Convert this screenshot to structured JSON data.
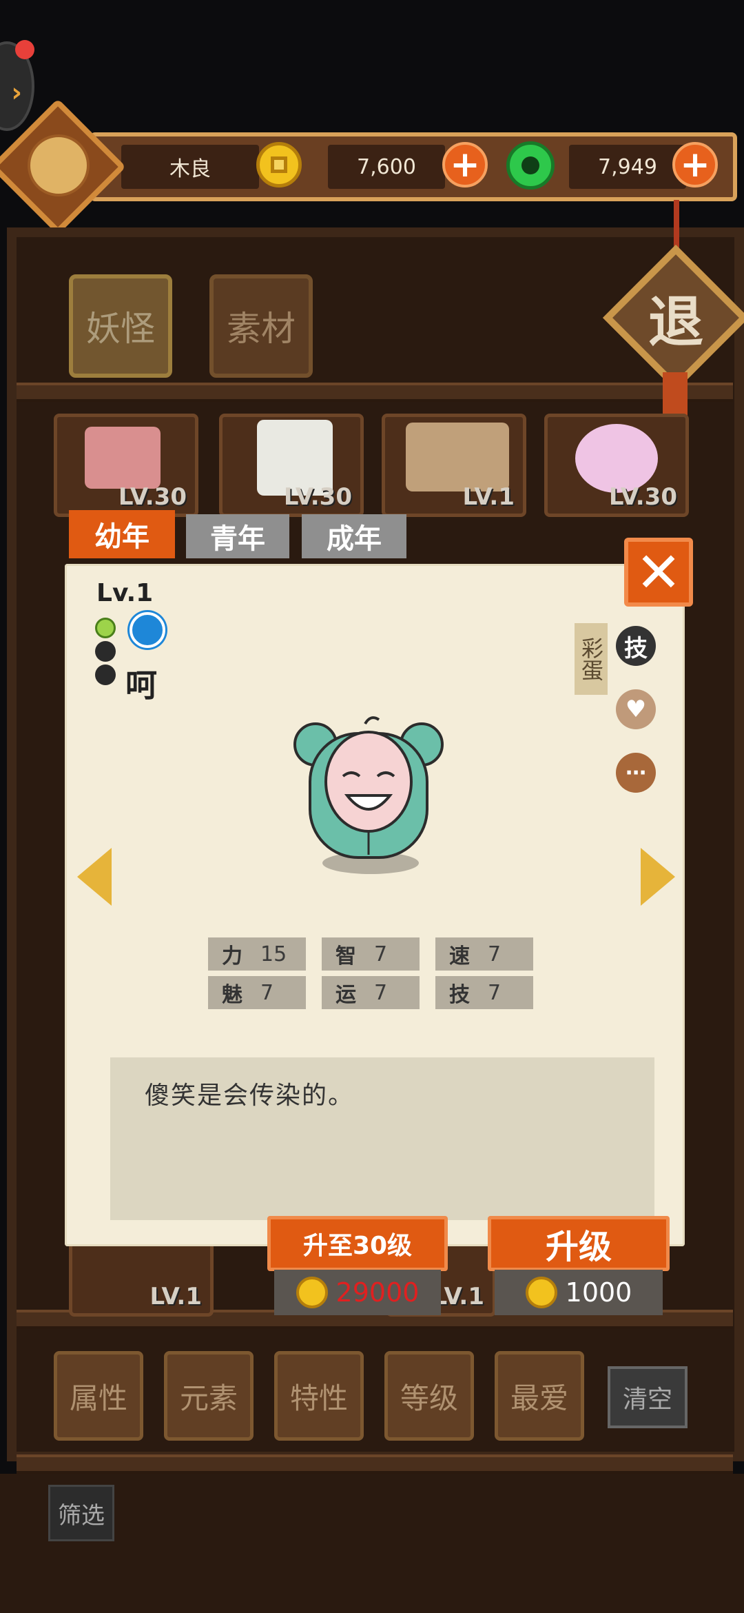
{
  "player": {
    "name": "木良"
  },
  "currency": {
    "gold": "7,600",
    "jade": "7,949"
  },
  "top_tabs": [
    "妖怪",
    "素材"
  ],
  "exit_label": "退",
  "cards_top_levels": [
    "LV.30",
    "LV.30",
    "LV.1",
    "LV.30"
  ],
  "cards_bottom_levels": [
    "LV.1",
    "LV.1"
  ],
  "age_tabs": [
    "幼年",
    "青年",
    "成年"
  ],
  "monster": {
    "level": "Lv.1",
    "name": "呵",
    "egg_label": "彩蛋",
    "skill_icon_label": "技",
    "description": "傻笑是会传染的。",
    "stats": [
      {
        "k": "力",
        "v": "15"
      },
      {
        "k": "智",
        "v": "7"
      },
      {
        "k": "速",
        "v": "7"
      },
      {
        "k": "魅",
        "v": "7"
      },
      {
        "k": "运",
        "v": "7"
      },
      {
        "k": "技",
        "v": "7"
      }
    ]
  },
  "upgrade": {
    "to30_label": "升至30级",
    "to30_cost": "29000",
    "upgrade_label": "升级",
    "upgrade_cost": "1000"
  },
  "bottom_filters": [
    "属性",
    "元素",
    "特性",
    "等级",
    "最爱"
  ],
  "clear_label": "清空",
  "filter_label": "筛选",
  "colors": {
    "accent": "#e05a12",
    "gold": "#f2c21e",
    "jade": "#2ec84b",
    "cost_red": "#e02020"
  }
}
